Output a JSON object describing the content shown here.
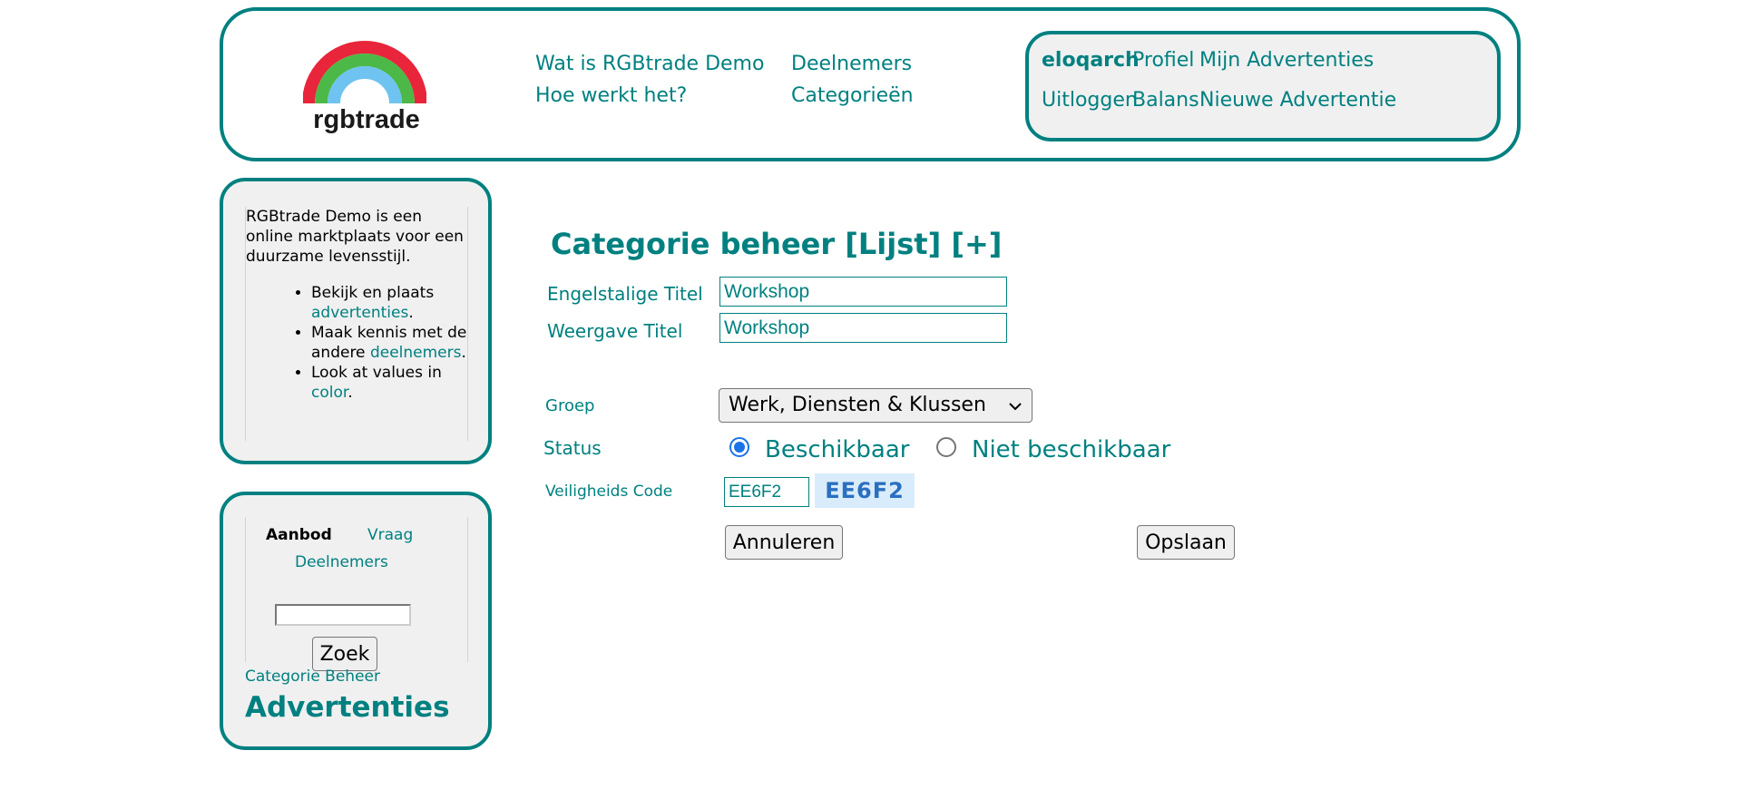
{
  "brand": {
    "logo_text": "rgbtrade"
  },
  "nav": {
    "wat_is": "Wat is RGBtrade Demo",
    "deelnemers": "Deelnemers",
    "hoe_werkt": "Hoe werkt het?",
    "categorieen": "Categorieën"
  },
  "user_nav": {
    "username": "eloqarch",
    "profiel": "Profiel",
    "mijn_advertenties": "Mijn Advertenties",
    "uitloggen": "Uitloggen",
    "balans": "Balans",
    "nieuwe_advertentie": "Nieuwe Advertentie"
  },
  "info": {
    "intro": "RGBtrade Demo is een online marktplaats voor een duurzame levensstijl.",
    "item1_text": "Bekijk en plaats",
    "item1_link": "advertenties",
    "item2_text": "Maak kennis met de andere",
    "item2_link": "deelnemers",
    "item3_text": "Look at values in",
    "item3_link": "color",
    "period": "."
  },
  "search": {
    "tab_aanbod": "Aanbod",
    "tab_vraag": "Vraag",
    "tab_deelnemers": "Deelnemers",
    "input_value": "",
    "button": "Zoek",
    "category_link": "Categorie Beheer",
    "section_heading": "Advertenties"
  },
  "form": {
    "title": "Categorie beheer [Lijst] [+]",
    "english_title_label": "Engelstalige Titel",
    "english_title_value": "Workshop",
    "display_title_label": "Weergave Titel",
    "display_title_value": "Workshop",
    "group_label": "Groep",
    "group_value": "Werk, Diensten & Klussen",
    "status_label": "Status",
    "status_options": [
      "Beschikbaar",
      "Niet beschikbaar"
    ],
    "status_selected": "Beschikbaar",
    "security_label": "Veiligheids Code",
    "security_input": "EE6F2",
    "captcha_text": "EE6F2",
    "cancel_button": "Annuleren",
    "save_button": "Opslaan"
  },
  "colors": {
    "accent": "#008080",
    "panel": "#f0f0f0",
    "radio_selected": "#1a73e8"
  }
}
